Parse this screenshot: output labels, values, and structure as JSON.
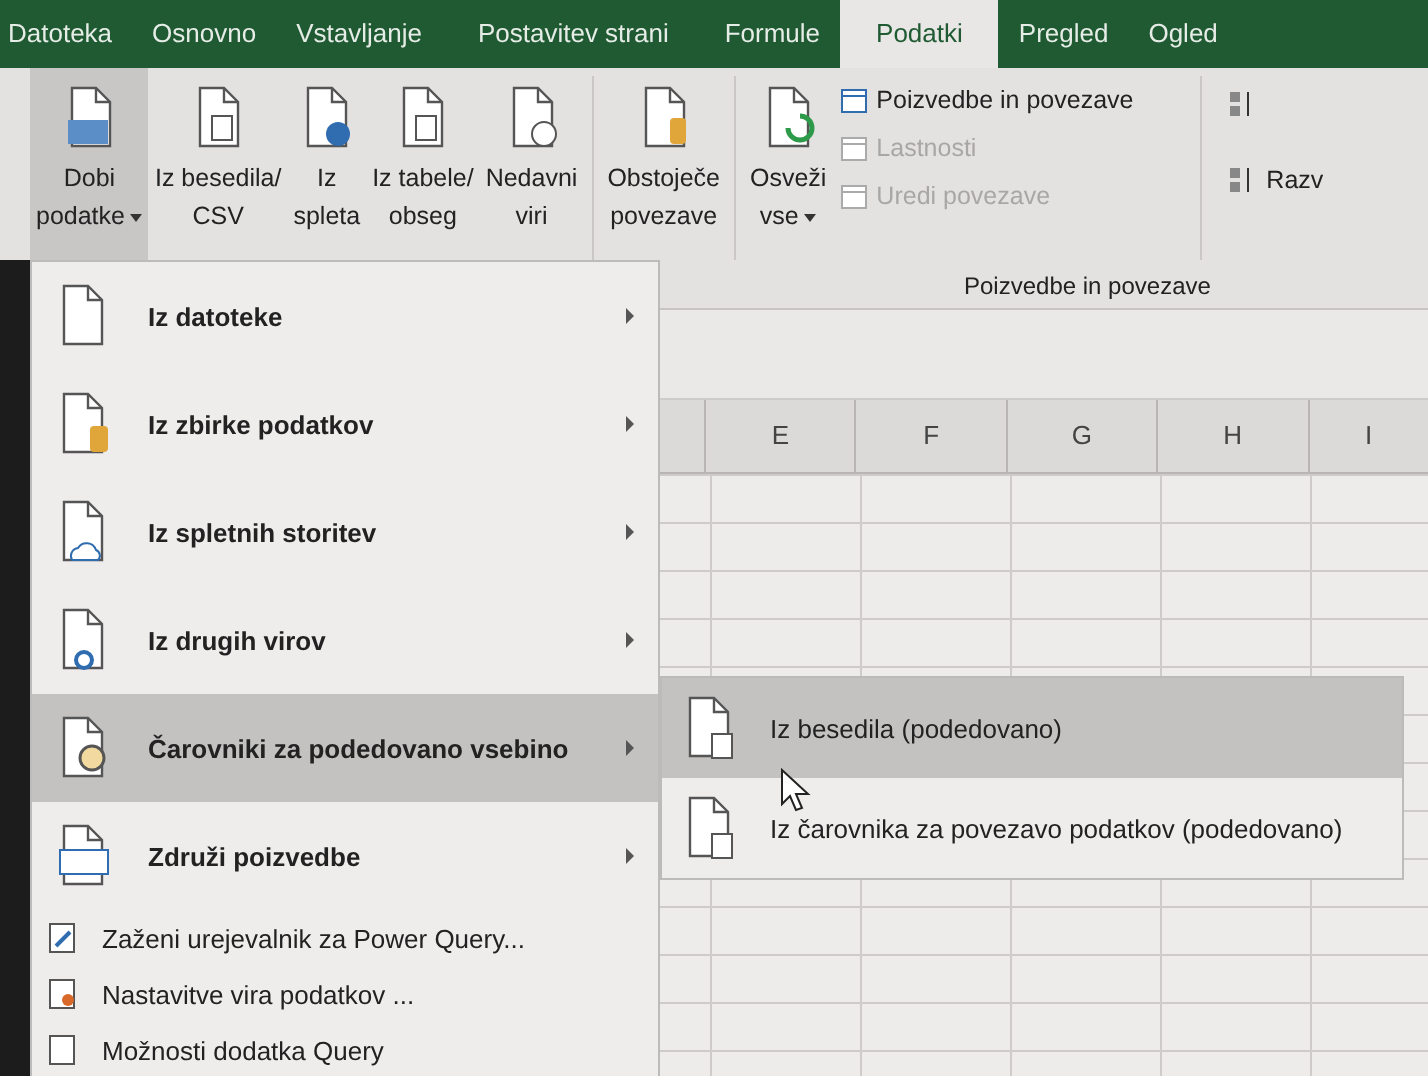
{
  "tabs": [
    {
      "label": "Datoteka",
      "selected": false
    },
    {
      "label": "Osnovno",
      "selected": false
    },
    {
      "label": "Vstavljanje",
      "selected": false
    },
    {
      "label": "Postavitev strani",
      "selected": false
    },
    {
      "label": "Formule",
      "selected": false
    },
    {
      "label": "Podatki",
      "selected": true
    },
    {
      "label": "Pregled",
      "selected": false
    },
    {
      "label": "Ogled",
      "selected": false
    }
  ],
  "ribbon": {
    "buttons": [
      {
        "label": "Dobi\npodatke",
        "dropdown": true,
        "pressed": true
      },
      {
        "label": "Iz besedila/\nCSV",
        "dropdown": false,
        "pressed": false
      },
      {
        "label": "Iz\nspleta",
        "dropdown": false,
        "pressed": false
      },
      {
        "label": "Iz tabele/\nobseg",
        "dropdown": false,
        "pressed": false
      },
      {
        "label": "Nedavni\nviri",
        "dropdown": false,
        "pressed": false
      },
      {
        "label": "Obstoječe\npovezave",
        "dropdown": false,
        "pressed": false
      },
      {
        "label": "Osveži\nvse",
        "dropdown": true,
        "pressed": false
      }
    ],
    "small_buttons": [
      {
        "label": "Poizvedbe in povezave",
        "disabled": false
      },
      {
        "label": "Lastnosti",
        "disabled": true
      },
      {
        "label": "Uredi povezave",
        "disabled": true
      }
    ],
    "group_label": "Poizvedbe in povezave",
    "sort_label": "Razv"
  },
  "columns": [
    "E",
    "F",
    "G",
    "H",
    "I"
  ],
  "menu": [
    {
      "label": "Iz datoteke",
      "kind": "large",
      "submenu": true,
      "selected": false
    },
    {
      "label": "Iz zbirke podatkov",
      "kind": "large",
      "submenu": true,
      "selected": false
    },
    {
      "label": "Iz spletnih storitev",
      "kind": "large",
      "submenu": true,
      "selected": false
    },
    {
      "label": "Iz drugih virov",
      "kind": "large",
      "submenu": true,
      "selected": false
    },
    {
      "label": "Čarovniki za podedovano vsebino",
      "kind": "large",
      "submenu": true,
      "selected": true
    },
    {
      "label": "Združi poizvedbe",
      "kind": "large",
      "submenu": true,
      "selected": false
    },
    {
      "label": "Zaženi urejevalnik za Power Query...",
      "kind": "small",
      "submenu": false,
      "selected": false
    },
    {
      "label": "Nastavitve vira podatkov ...",
      "kind": "small",
      "submenu": false,
      "selected": false
    },
    {
      "label": "Možnosti dodatka Query",
      "kind": "small",
      "submenu": false,
      "selected": false
    }
  ],
  "submenu": [
    {
      "label": "Iz besedila (podedovano)",
      "selected": true
    },
    {
      "label": "Iz čarovnika za povezavo podatkov (podedovano)",
      "selected": false
    }
  ]
}
